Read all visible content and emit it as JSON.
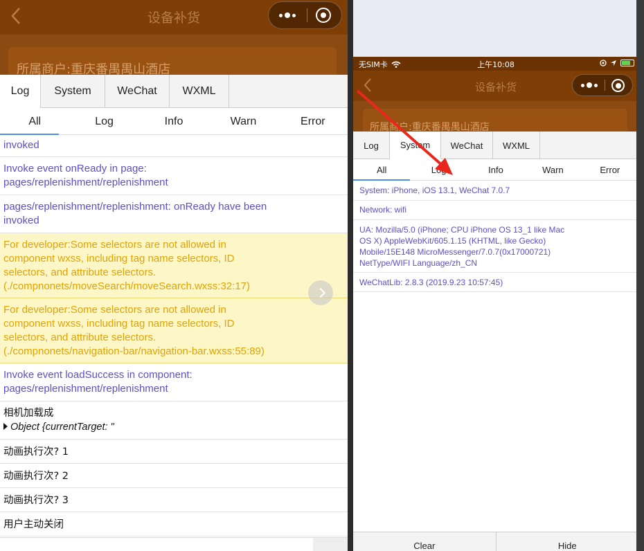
{
  "page_title": "设备补货",
  "merchant": "所属商户:重庆番禺禺山酒店",
  "left": {
    "tabs": [
      "Log",
      "System",
      "WeChat",
      "WXML"
    ],
    "filters": [
      "All",
      "Log",
      "Info",
      "Warn",
      "Error"
    ],
    "logs": {
      "partial": "invoked",
      "r1a": "Invoke event onReady in page:",
      "r1b": "pages/replenishment/replenishment",
      "r2a": "pages/replenishment/replenishment: onReady have been",
      "r2b": "invoked",
      "w1a": "For developer:Some selectors are not allowed in",
      "w1b": "component wxss, including tag name selectors, ID",
      "w1c": "selectors, and attribute selectors.",
      "w1d": "(./compnonets/moveSearch/moveSearch.wxss:32:17)",
      "w2a": "For developer:Some selectors are not allowed in",
      "w2b": "component wxss, including tag name selectors, ID",
      "w2c": "selectors, and attribute selectors.",
      "w2d": "(./compnonets/navigation-bar/navigation-bar.wxss:55:89)",
      "r3a": "Invoke event loadSuccess in component:",
      "r3b": "pages/replenishment/replenishment",
      "p1a": "相机加载成",
      "p1b": "Object {currentTarget: \"",
      "p2": "动画执行次? 1",
      "p3": "动画执行次? 2",
      "p4": "动画执行次? 3",
      "p5": "用户主动关闭"
    }
  },
  "right": {
    "status": {
      "carrier": "无SIM卡",
      "time": "上午10:08"
    },
    "tabs": [
      "Log",
      "System",
      "WeChat",
      "WXML"
    ],
    "filters": [
      "All",
      "Log",
      "Info",
      "Warn",
      "Error"
    ],
    "system": {
      "sys": "System: iPhone, iOS 13.1, WeChat 7.0.7",
      "net": "Network: wifi",
      "ua1": "UA: Mozilla/5.0 (iPhone; CPU iPhone OS 13_1 like Mac",
      "ua2": "OS X) AppleWebKit/605.1.15 (KHTML, like Gecko)",
      "ua3": "Mobile/15E148 MicroMessenger/7.0.7(0x17000721)",
      "ua4": "NetType/WIFI Language/zh_CN",
      "lib": "WeChatLib: 2.8.3 (2019.9.23 10:57:45)"
    },
    "footer": {
      "clear": "Clear",
      "hide": "Hide"
    }
  },
  "colors": {
    "nav_brown": "#7e3e06",
    "log_text": "#5b4fc9",
    "warn_bg": "#fdf7c8",
    "warn_text": "#e3a200",
    "arrow": "#e8281c"
  }
}
